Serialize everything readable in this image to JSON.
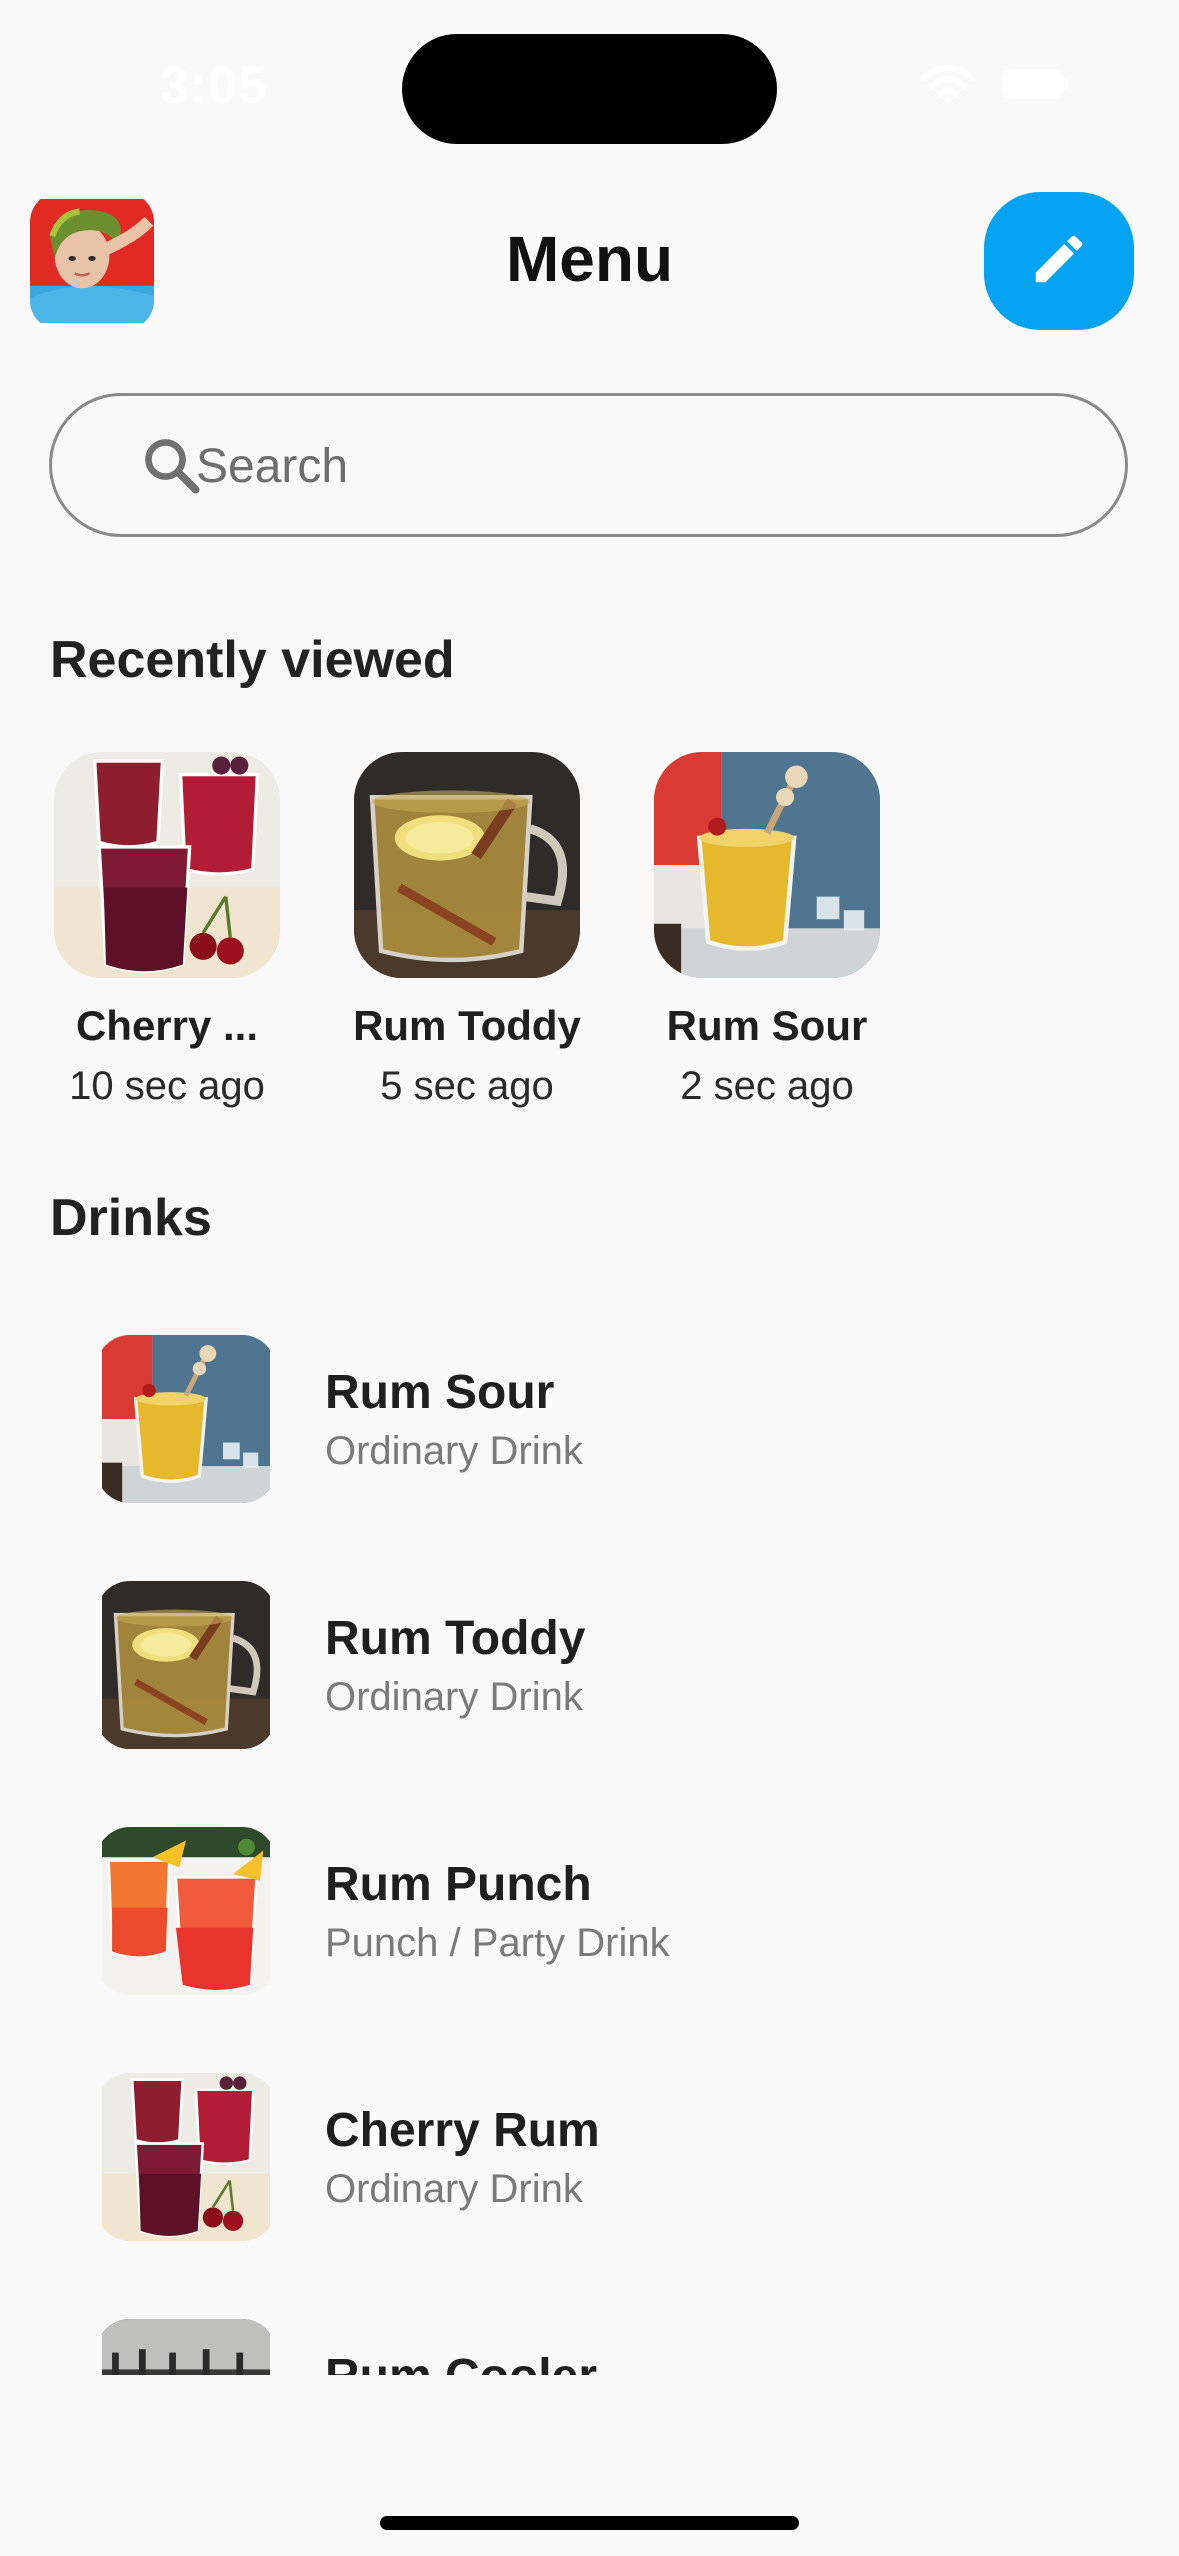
{
  "status_bar": {
    "time": "3:05"
  },
  "header": {
    "title": "Menu",
    "avatar_icon": "profile-avatar",
    "edit_icon": "pencil-icon",
    "edit_color": "#05a3f2"
  },
  "search": {
    "placeholder": "Search",
    "value": ""
  },
  "recent": {
    "title": "Recently viewed",
    "items": [
      {
        "name": "Cherry ...",
        "time": "10 sec ago",
        "image": "cherry-rum"
      },
      {
        "name": "Rum Toddy",
        "time": "5 sec ago",
        "image": "rum-toddy"
      },
      {
        "name": "Rum Sour",
        "time": "2 sec ago",
        "image": "rum-sour"
      }
    ]
  },
  "drinks": {
    "title": "Drinks",
    "items": [
      {
        "name": "Rum Sour",
        "category": "Ordinary Drink",
        "image": "rum-sour"
      },
      {
        "name": "Rum Toddy",
        "category": "Ordinary Drink",
        "image": "rum-toddy"
      },
      {
        "name": "Rum Punch",
        "category": "Punch / Party Drink",
        "image": "rum-punch"
      },
      {
        "name": "Cherry Rum",
        "category": "Ordinary Drink",
        "image": "cherry-rum"
      },
      {
        "name": "Rum Cooler",
        "category": "",
        "image": "rum-cooler"
      }
    ]
  }
}
